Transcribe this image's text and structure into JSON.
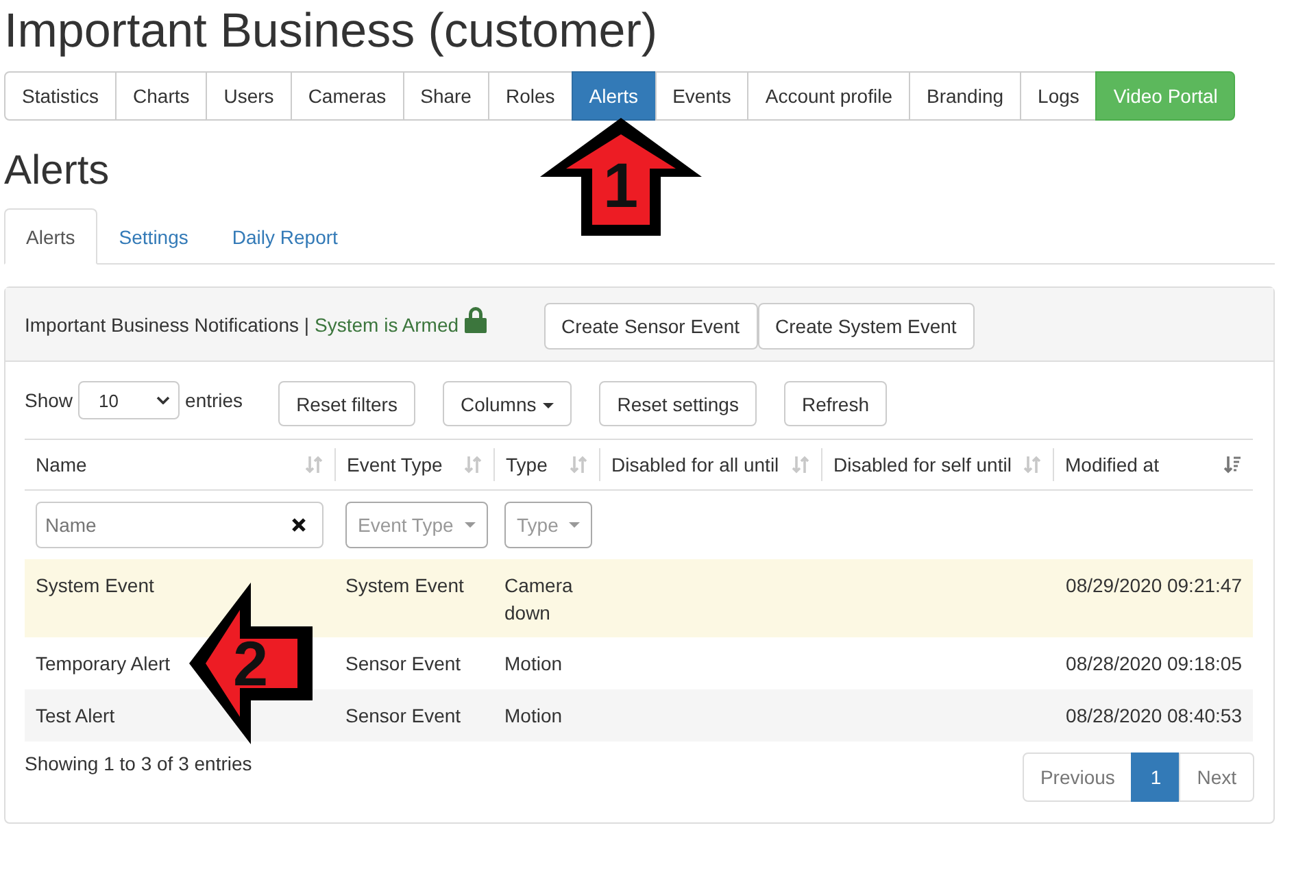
{
  "page_title": "Important Business (customer)",
  "nav": [
    {
      "label": "Statistics",
      "kind": "tab",
      "selected": false
    },
    {
      "label": "Charts",
      "kind": "tab",
      "selected": false
    },
    {
      "label": "Users",
      "kind": "tab",
      "selected": false
    },
    {
      "label": "Cameras",
      "kind": "tab",
      "selected": false
    },
    {
      "label": "Share",
      "kind": "tab",
      "selected": false
    },
    {
      "label": "Roles",
      "kind": "tab",
      "selected": false
    },
    {
      "label": "Alerts",
      "kind": "tab",
      "selected": true
    },
    {
      "label": "Events",
      "kind": "tab",
      "selected": false
    },
    {
      "label": "Account profile",
      "kind": "tab",
      "selected": false
    },
    {
      "label": "Branding",
      "kind": "tab",
      "selected": false
    },
    {
      "label": "Logs",
      "kind": "tab",
      "selected": false
    },
    {
      "label": "Video Portal",
      "kind": "portal",
      "selected": false
    }
  ],
  "section_title": "Alerts",
  "subtabs": [
    {
      "label": "Alerts",
      "selected": true
    },
    {
      "label": "Settings",
      "selected": false
    },
    {
      "label": "Daily Report",
      "selected": false
    }
  ],
  "panel": {
    "heading": "Important Business Notifications |",
    "status": "System is Armed",
    "locked": true,
    "buttons": [
      "Create Sensor Event",
      "Create System Event"
    ]
  },
  "toolbar": {
    "show_label": "Show",
    "page_size": "10",
    "entries_label": "entries",
    "buttons": [
      {
        "label": "Reset filters",
        "kind": "plain"
      },
      {
        "label": "Columns",
        "kind": "dropdown"
      },
      {
        "label": "Reset settings",
        "kind": "plain"
      },
      {
        "label": "Refresh",
        "kind": "plain"
      }
    ]
  },
  "table": {
    "columns": [
      {
        "label": "Name",
        "kind": "sortable",
        "filter": {
          "kind": "text",
          "placeholder": "Name"
        }
      },
      {
        "label": "Event Type",
        "kind": "sortable",
        "filter": {
          "kind": "select",
          "placeholder": "Event Type"
        }
      },
      {
        "label": "Type",
        "kind": "sortable",
        "filter": {
          "kind": "select",
          "placeholder": "Type"
        }
      },
      {
        "label": "Disabled for all until",
        "kind": "sortable"
      },
      {
        "label": "Disabled for self until",
        "kind": "sortable"
      },
      {
        "label": "Modified at",
        "kind": "sorted"
      }
    ],
    "rows": [
      {
        "cells": [
          "System Event",
          "System Event",
          "Camera down",
          "",
          "",
          "08/29/2020 09:21:47"
        ],
        "highlighted": true
      },
      {
        "cells": [
          "Temporary Alert",
          "Sensor Event",
          "Motion",
          "",
          "",
          "08/28/2020 09:18:05"
        ],
        "highlighted": false
      },
      {
        "cells": [
          "Test Alert",
          "Sensor Event",
          "Motion",
          "",
          "",
          "08/28/2020 08:40:53"
        ],
        "highlighted": false
      }
    ]
  },
  "info": "Showing 1 to 3 of 3 entries",
  "pagination": [
    {
      "label": "Previous",
      "selected": false
    },
    {
      "label": "1",
      "selected": true
    },
    {
      "label": "Next",
      "selected": false
    }
  ],
  "annotations": [
    {
      "label": "1",
      "kind": "up"
    },
    {
      "label": "2",
      "kind": "left"
    }
  ]
}
